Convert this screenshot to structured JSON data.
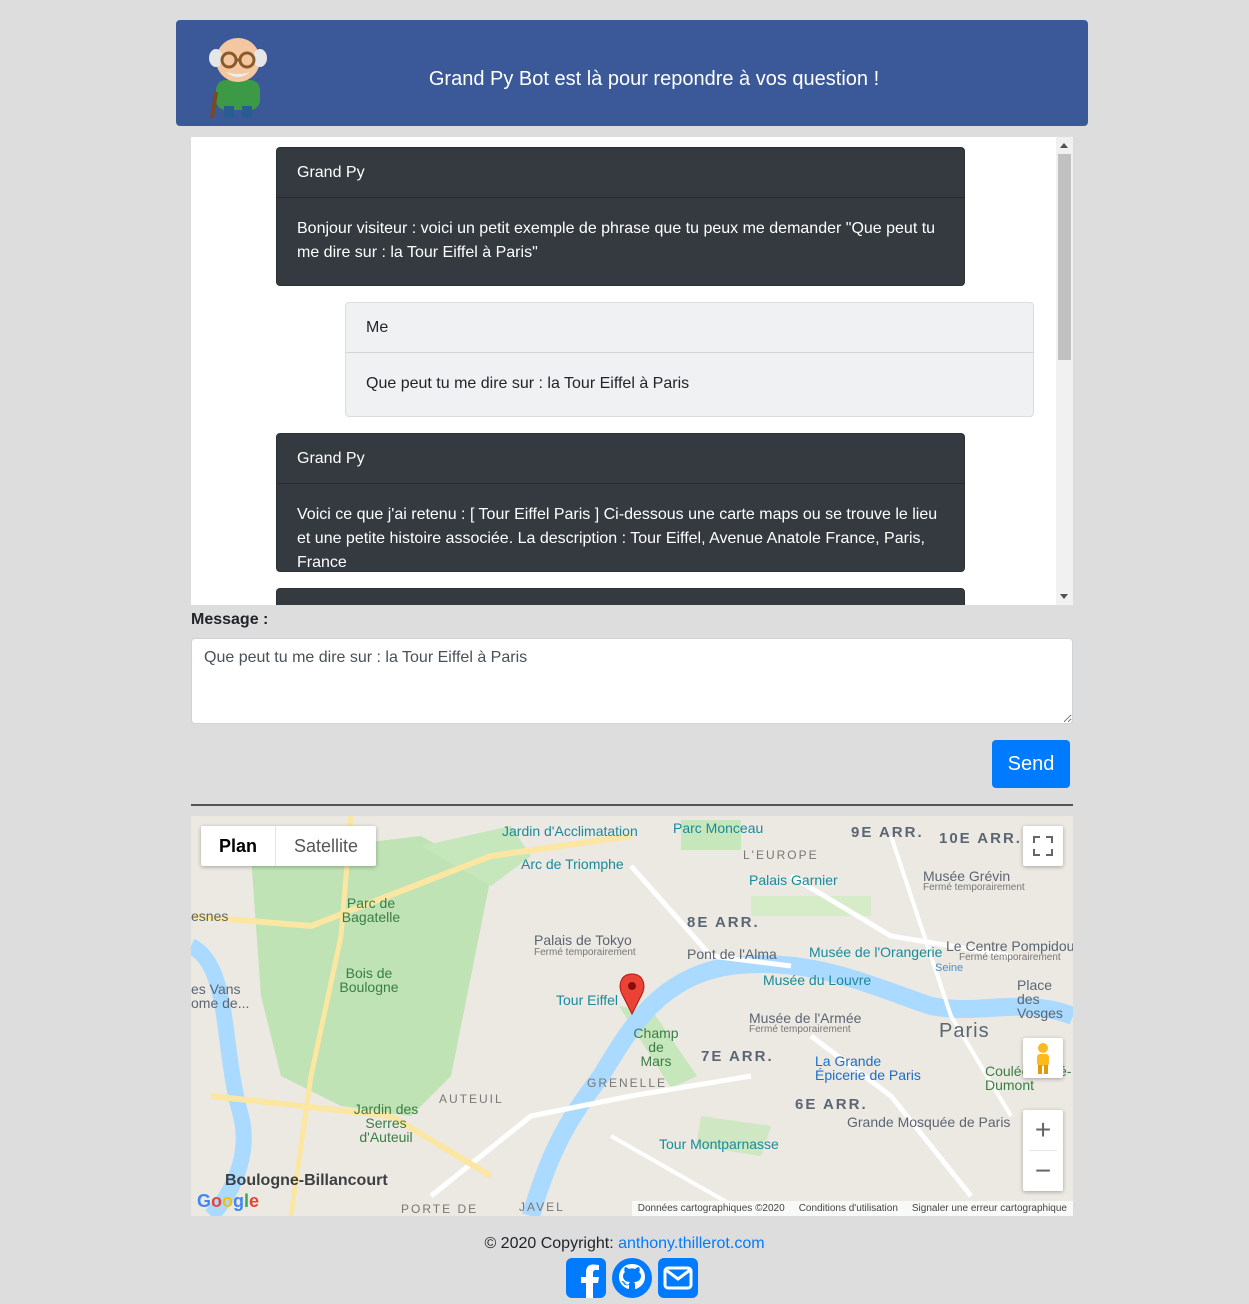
{
  "header": {
    "title": "Grand Py Bot est là pour repondre à vos question !"
  },
  "chat": {
    "messages": [
      {
        "author": "Grand Py",
        "text": "Bonjour visiteur : voici un petit exemple de phrase que tu peux me demander \"Que peut tu me dire sur : la Tour Eiffel à Paris\""
      },
      {
        "author": "Me",
        "text": "Que peut tu me dire sur : la Tour Eiffel à Paris"
      },
      {
        "author": "Grand Py",
        "text": "Voici ce que j'ai retenu : [ Tour Eiffel Paris ] Ci-dessous une carte maps ou se trouve le lieu et une petite histoire associée. La description : Tour Eiffel, Avenue Anatole France, Paris, France"
      }
    ]
  },
  "form": {
    "label": "Message :",
    "value": "Que peut tu me dire sur : la Tour Eiffel à Paris",
    "send_label": "Send"
  },
  "map": {
    "type_options": [
      "Plan",
      "Satellite"
    ],
    "selected_type": "Plan",
    "marker_label": "Tour Eiffel",
    "places": {
      "jardin_acclimatation": "Jardin d'Acclimatation",
      "parc_monceau": "Parc Monceau",
      "arr9": "9E ARR.",
      "arr10": "10E ARR.",
      "europe": "L'EUROPE",
      "arc": "Arc de Triomphe",
      "palais_garnier": "Palais Garnier",
      "musee_grevin": "Musée Grévin",
      "grevin_note": "Fermé temporairement",
      "parc_bagatelle": "Parc de Bagatelle",
      "arr8": "8E ARR.",
      "palais_tokyo": "Palais de Tokyo",
      "tokyo_note": "Fermé temporairement",
      "pont_alma": "Pont de l'Alma",
      "orangerie": "Musée de l'Orangerie",
      "pompidou": "Le Centre Pompidou",
      "pompidou_note": "Fermé temporairement",
      "bois_boulogne": "Bois de Boulogne",
      "louvre": "Musée du Louvre",
      "place_vosges": "Place des Vosges",
      "tour_eiffel": "Tour Eiffel",
      "armee": "Musée de l'Armée",
      "armee_note": "Fermé temporairement",
      "paris": "Paris",
      "champ_mars": "Champ de Mars",
      "arr7": "7E ARR.",
      "grande_epicerie": "La Grande Épicerie de Paris",
      "coulee": "Coulée René-Dumont",
      "grenelle": "GRENELLE",
      "auteuil": "AUTEUIL",
      "jardin_serres": "Jardin des Serres d'Auteuil",
      "arr6": "6E ARR.",
      "mosquee": "Grande Mosquée de Paris",
      "montparnasse": "Tour Montparnasse",
      "boulogne": "Boulogne-Billancourt",
      "javel": "JAVEL",
      "porte": "PORTE DE",
      "seine": "Seine",
      "vans": "es Vans ome de...",
      "snes": "esnes"
    },
    "attribution": [
      "Données cartographiques ©2020",
      "Conditions d'utilisation",
      "Signaler une erreur cartographique"
    ],
    "logo": "Google"
  },
  "footer": {
    "copyright": "© 2020 Copyright:",
    "link": "anthony.thillerot.com"
  },
  "icons": {
    "facebook": "facebook-icon",
    "github": "github-icon",
    "mail": "mail-icon"
  },
  "colors": {
    "header": "#3b5998",
    "bot_bubble": "#343a40",
    "me_bubble": "#f0f1f2",
    "send": "#007bff",
    "link": "#007bff"
  }
}
